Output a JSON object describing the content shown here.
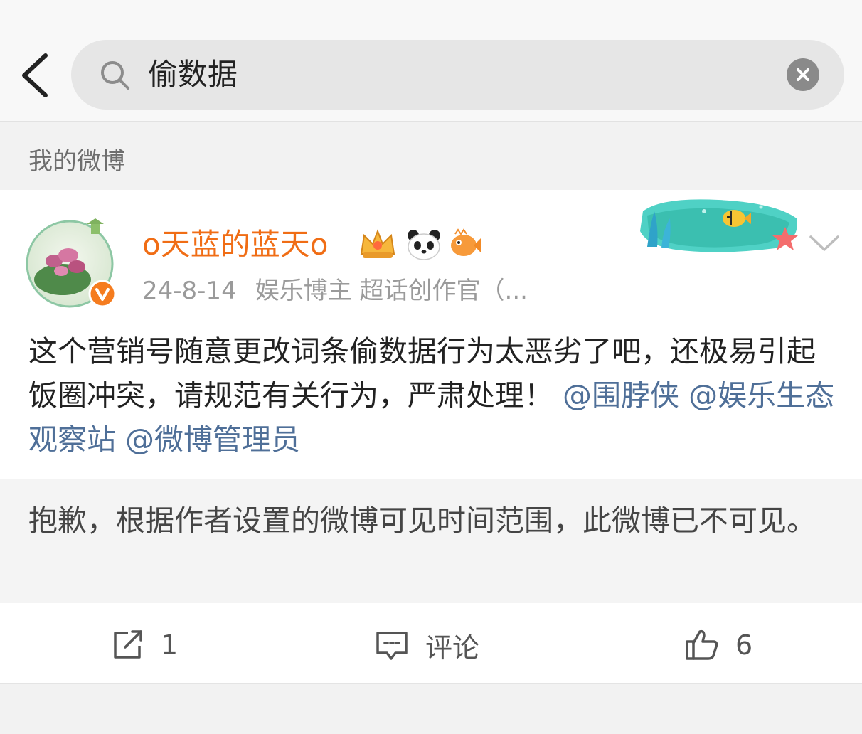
{
  "search": {
    "query": "偷数据"
  },
  "section": {
    "label": "我的微博"
  },
  "post": {
    "username": "o天蓝的蓝天o",
    "date": "24-8-14",
    "role": "娱乐博主 超话创作官（...",
    "text": "这个营销号随意更改词条偷数据行为太恶劣了吧，还极易引起饭圈冲突，请规范有关行为，严肃处理！",
    "mentions": [
      "@围脖侠",
      "@娱乐生态观察站",
      "@微博管理员"
    ]
  },
  "notice": {
    "text": "抱歉，根据作者设置的微博可见时间范围，此微博已不可见。"
  },
  "actions": {
    "repost_count": "1",
    "comment_label": "评论",
    "like_count": "6"
  },
  "colors": {
    "username": "#f06d15",
    "mention": "#4f6f98",
    "verified": "#f57c1f"
  },
  "icons": [
    "back-arrow-icon",
    "search-icon",
    "clear-icon",
    "verified-icon",
    "crown-badge-icon",
    "panda-badge-icon",
    "fish-badge-icon",
    "chevron-down-icon",
    "repost-icon",
    "comment-icon",
    "like-icon"
  ]
}
